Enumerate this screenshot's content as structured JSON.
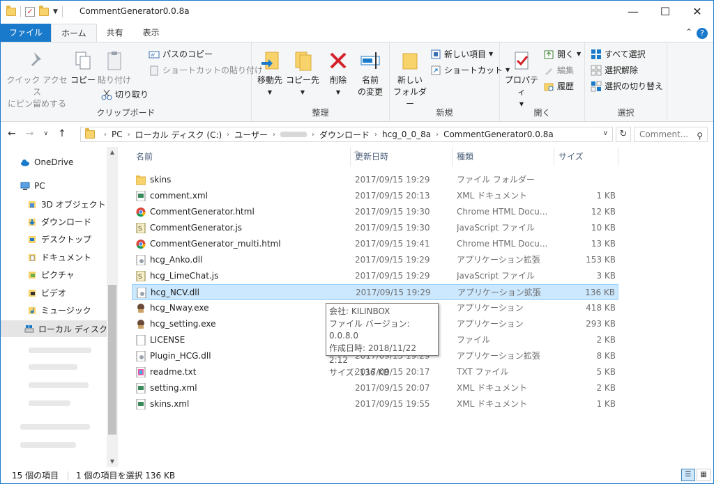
{
  "window": {
    "title": "CommentGenerator0.0.8a",
    "minimize": "—",
    "maximize": "☐",
    "close": "✕"
  },
  "ribbon_tabs": [
    "ファイル",
    "ホーム",
    "共有",
    "表示"
  ],
  "ribbon": {
    "clipboard": {
      "label": "クリップボード",
      "pin": "クイック アクセス\nにピン留めする",
      "pin_l1": "クイック アクセス",
      "pin_l2": "にピン留めする",
      "copy": "コピー",
      "paste": "貼り付け",
      "copy_path": "パスのコピー",
      "paste_shortcut": "ショートカットの貼り付け",
      "cut": "切り取り"
    },
    "organize": {
      "label": "整理",
      "move_to": "移動先",
      "copy_to": "コピー先",
      "delete": "削除",
      "rename_l1": "名前",
      "rename_l2": "の変更"
    },
    "new": {
      "label": "新規",
      "new_folder_l1": "新しい",
      "new_folder_l2": "フォルダー",
      "new_item": "新しい項目",
      "shortcut": "ショートカット"
    },
    "open": {
      "label": "開く",
      "properties": "プロパティ",
      "open": "開く",
      "edit": "編集",
      "history": "履歴"
    },
    "select": {
      "label": "選択",
      "select_all": "すべて選択",
      "select_none": "選択解除",
      "invert": "選択の切り替え"
    }
  },
  "address": {
    "crumbs": [
      "PC",
      "ローカル ディスク (C:)",
      "ユーザー",
      "ダウンロード",
      "hcg_0_0_8a",
      "CommentGenerator0.0.8a"
    ],
    "search_placeholder": "Comment..."
  },
  "nav_pane": {
    "items": [
      {
        "label": "OneDrive",
        "icon": "cloud-icon"
      },
      {
        "label": "PC",
        "icon": "pc-icon"
      },
      {
        "label": "3D オブジェクト",
        "icon": "3d-objects-icon"
      },
      {
        "label": "ダウンロード",
        "icon": "downloads-icon"
      },
      {
        "label": "デスクトップ",
        "icon": "desktop-icon"
      },
      {
        "label": "ドキュメント",
        "icon": "documents-icon"
      },
      {
        "label": "ピクチャ",
        "icon": "pictures-icon"
      },
      {
        "label": "ビデオ",
        "icon": "videos-icon"
      },
      {
        "label": "ミュージック",
        "icon": "music-icon"
      },
      {
        "label": "ローカル ディスク (C",
        "icon": "drive-icon"
      }
    ]
  },
  "columns": [
    "名前",
    "更新日時",
    "種類",
    "サイズ"
  ],
  "files": [
    {
      "name": "skins",
      "date": "2017/09/15 19:29",
      "type": "ファイル フォルダー",
      "size": "",
      "icon": "folder-icon"
    },
    {
      "name": "comment.xml",
      "date": "2017/09/15 20:13",
      "type": "XML ドキュメント",
      "size": "1 KB",
      "icon": "xml-file-icon"
    },
    {
      "name": "CommentGenerator.html",
      "date": "2017/09/15 19:30",
      "type": "Chrome HTML Docu...",
      "size": "12 KB",
      "icon": "chrome-icon"
    },
    {
      "name": "CommentGenerator.js",
      "date": "2017/09/15 19:30",
      "type": "JavaScript ファイル",
      "size": "10 KB",
      "icon": "script-file-icon"
    },
    {
      "name": "CommentGenerator_multi.html",
      "date": "2017/09/15 19:41",
      "type": "Chrome HTML Docu...",
      "size": "13 KB",
      "icon": "chrome-icon"
    },
    {
      "name": "hcg_Anko.dll",
      "date": "2017/09/15 19:29",
      "type": "アプリケーション拡張",
      "size": "153 KB",
      "icon": "dll-file-icon"
    },
    {
      "name": "hcg_LimeChat.js",
      "date": "2017/09/15 19:29",
      "type": "JavaScript ファイル",
      "size": "3 KB",
      "icon": "script-file-icon"
    },
    {
      "name": "hcg_NCV.dll",
      "date": "2017/09/15 19:29",
      "type": "アプリケーション拡張",
      "size": "136 KB",
      "icon": "dll-file-icon"
    },
    {
      "name": "hcg_Nway.exe",
      "date": "2017/09/15 19:29",
      "type": "アプリケーション",
      "size": "418 KB",
      "icon": "app-exe-icon"
    },
    {
      "name": "hcg_setting.exe",
      "date": "2017/09/15 19:29",
      "type": "アプリケーション",
      "size": "293 KB",
      "icon": "app-exe-icon"
    },
    {
      "name": "LICENSE",
      "date": "2017/09/15 19:29",
      "type": "ファイル",
      "size": "2 KB",
      "icon": "blank-file-icon"
    },
    {
      "name": "Plugin_HCG.dll",
      "date": "2017/09/15 19:29",
      "type": "アプリケーション拡張",
      "size": "8 KB",
      "icon": "dll-file-icon"
    },
    {
      "name": "readme.txt",
      "date": "2017/09/15 20:17",
      "type": "TXT ファイル",
      "size": "5 KB",
      "icon": "text-file-icon"
    },
    {
      "name": "setting.xml",
      "date": "2017/09/15 20:07",
      "type": "XML ドキュメント",
      "size": "2 KB",
      "icon": "xml-file-icon"
    },
    {
      "name": "skins.xml",
      "date": "2017/09/15 19:55",
      "type": "XML ドキュメント",
      "size": "1 KB",
      "icon": "xml-file-icon"
    }
  ],
  "selected_index": 7,
  "tooltip": {
    "company": "会社: KILINBOX",
    "version": "ファイル バージョン: 0.0.8.0",
    "created": "作成日時: 2018/11/22 2:12",
    "size": "サイズ: 136 KB"
  },
  "status": {
    "count": "15 個の項目",
    "selection": "1 個の項目を選択  136 KB"
  },
  "colors": {
    "accent": "#1979ca",
    "selection": "#cce8ff",
    "folder": "#f8d26a"
  }
}
